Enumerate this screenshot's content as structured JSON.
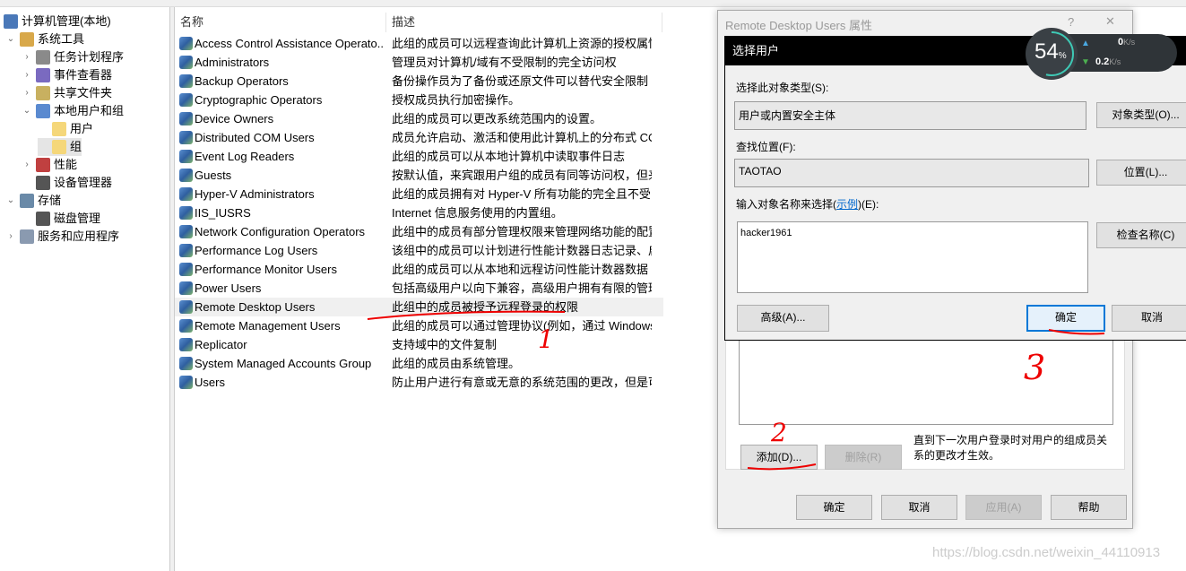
{
  "tree": {
    "root": "计算机管理(本地)",
    "items": [
      {
        "label": "系统工具",
        "level": 1,
        "chevron": "down"
      },
      {
        "label": "任务计划程序",
        "level": 2,
        "chevron": "right"
      },
      {
        "label": "事件查看器",
        "level": 2,
        "chevron": "right"
      },
      {
        "label": "共享文件夹",
        "level": 2,
        "chevron": "right"
      },
      {
        "label": "本地用户和组",
        "level": 2,
        "chevron": "down"
      },
      {
        "label": "用户",
        "level": 3,
        "chevron": ""
      },
      {
        "label": "组",
        "level": 3,
        "chevron": "",
        "selected": true
      },
      {
        "label": "性能",
        "level": 2,
        "chevron": "right"
      },
      {
        "label": "设备管理器",
        "level": 2,
        "chevron": ""
      },
      {
        "label": "存储",
        "level": 1,
        "chevron": "down"
      },
      {
        "label": "磁盘管理",
        "level": 2,
        "chevron": ""
      },
      {
        "label": "服务和应用程序",
        "level": 1,
        "chevron": "right"
      }
    ]
  },
  "list": {
    "columns": [
      "名称",
      "描述"
    ],
    "rows": [
      {
        "name": "Access Control Assistance Operato...",
        "desc": "此组的成员可以远程查询此计算机上资源的授权属性..."
      },
      {
        "name": "Administrators",
        "desc": "管理员对计算机/域有不受限制的完全访问权"
      },
      {
        "name": "Backup Operators",
        "desc": "备份操作员为了备份或还原文件可以替代安全限制"
      },
      {
        "name": "Cryptographic Operators",
        "desc": "授权成员执行加密操作。"
      },
      {
        "name": "Device Owners",
        "desc": "此组的成员可以更改系统范围内的设置。"
      },
      {
        "name": "Distributed COM Users",
        "desc": "成员允许启动、激活和使用此计算机上的分布式 COM..."
      },
      {
        "name": "Event Log Readers",
        "desc": "此组的成员可以从本地计算机中读取事件日志"
      },
      {
        "name": "Guests",
        "desc": "按默认值，来宾跟用户组的成员有同等访问权，但来..."
      },
      {
        "name": "Hyper-V Administrators",
        "desc": "此组的成员拥有对 Hyper-V 所有功能的完全且不受限..."
      },
      {
        "name": "IIS_IUSRS",
        "desc": "Internet 信息服务使用的内置组。"
      },
      {
        "name": "Network Configuration Operators",
        "desc": "此组中的成员有部分管理权限来管理网络功能的配置"
      },
      {
        "name": "Performance Log Users",
        "desc": "该组中的成员可以计划进行性能计数器日志记录、启..."
      },
      {
        "name": "Performance Monitor Users",
        "desc": "此组的成员可以从本地和远程访问性能计数器数据"
      },
      {
        "name": "Power Users",
        "desc": "包括高级用户以向下兼容，高级用户拥有有限的管理..."
      },
      {
        "name": "Remote Desktop Users",
        "desc": "此组中的成员被授予远程登录的权限",
        "highlighted": true
      },
      {
        "name": "Remote Management Users",
        "desc": "此组的成员可以通过管理协议(例如，通过 Windows ..."
      },
      {
        "name": "Replicator",
        "desc": "支持域中的文件复制"
      },
      {
        "name": "System Managed Accounts Group",
        "desc": "此组的成员由系统管理。"
      },
      {
        "name": "Users",
        "desc": "防止用户进行有意或无意的系统范围的更改，但是可..."
      }
    ]
  },
  "props_dialog": {
    "title": "Remote Desktop Users 属性",
    "help": "?",
    "close": "✕",
    "add": "添加(D)...",
    "remove": "删除(R)",
    "note": "直到下一次用户登录时对用户的组成员关系的更改才生效。",
    "ok": "确定",
    "cancel": "取消",
    "apply": "应用(A)",
    "helpbtn": "帮助"
  },
  "select_dialog": {
    "title": "选择用户",
    "close": "✕",
    "type_label": "选择此对象类型(S):",
    "type_value": "用户或内置安全主体",
    "type_btn": "对象类型(O)...",
    "loc_label": "查找位置(F):",
    "loc_value": "TAOTAO",
    "loc_btn": "位置(L)...",
    "name_label_pre": "输入对象名称来选择(",
    "name_label_link": "示例",
    "name_label_post": ")(E):",
    "name_value": "hacker1961",
    "check_btn": "检查名称(C)",
    "advanced": "高级(A)...",
    "ok": "确定",
    "cancel": "取消"
  },
  "gauge": {
    "percent": "54",
    "unit": "%",
    "up": "0",
    "down": "0.2",
    "rate_unit": "K/s",
    "level": 0.54
  },
  "annotations": [
    "1",
    "2",
    "3"
  ],
  "watermark": "https://blog.csdn.net/weixin_44110913",
  "colors": {
    "annotation": "#e00000",
    "accent": "#0078d7",
    "gauge_ring": "#3ec9b5"
  }
}
